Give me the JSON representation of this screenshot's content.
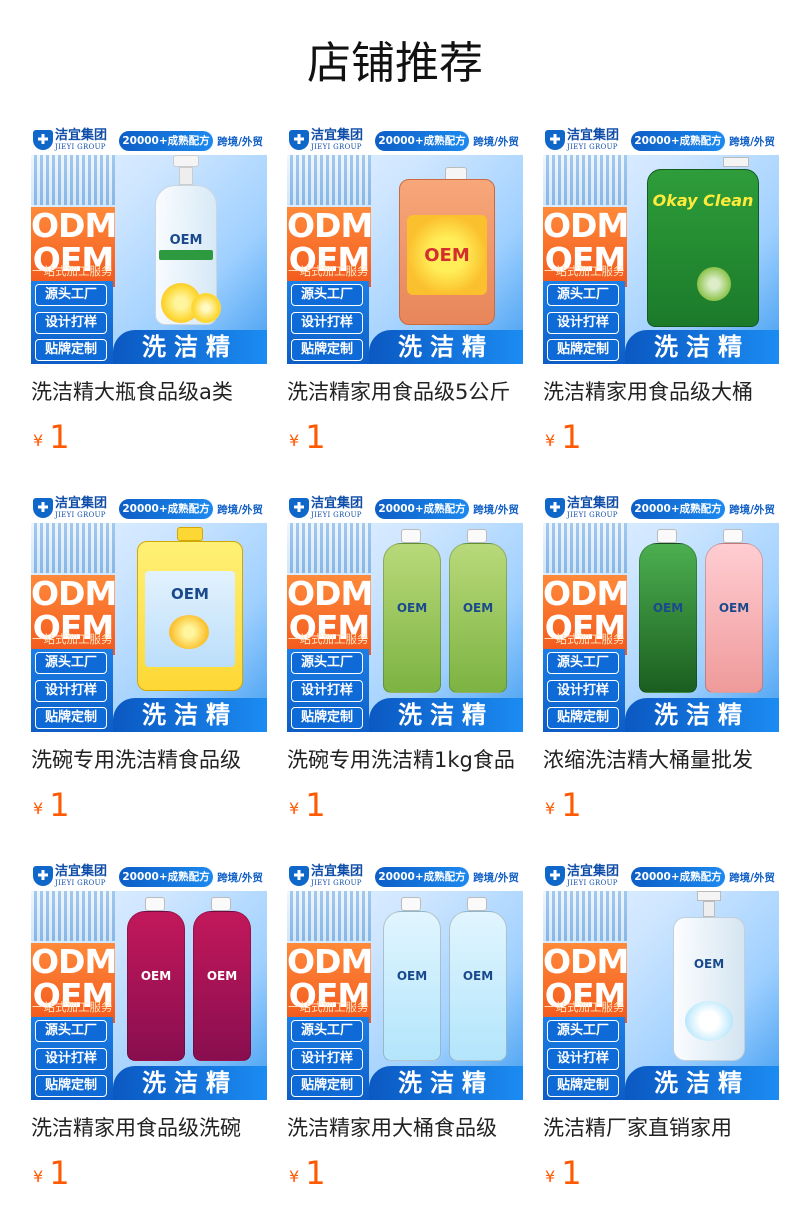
{
  "page": {
    "title": "店铺推荐"
  },
  "banner": {
    "brand": "洁宜集团",
    "brand_en": "JIEYI GROUP",
    "formula": "20000+成熟配方",
    "crossborder": "跨境/外贸",
    "odm": "ODM",
    "oem": "OEM",
    "service": "一站式加工服务",
    "tag1": "源头工厂",
    "tag2": "设计打样",
    "tag3": "贴牌定制",
    "bottom": "洗洁精"
  },
  "currency_symbol": "¥",
  "products": [
    {
      "title": "洗洁精大瓶食品级a类",
      "price": "1",
      "label": "OEM",
      "icon": "pump-bottle-lemon-icon"
    },
    {
      "title": "洗洁精家用食品级5公斤",
      "price": "1",
      "label": "OEM",
      "icon": "jerry-can-orange-icon"
    },
    {
      "title": "洗洁精家用食品级大桶",
      "price": "1",
      "label": "Okay Clean",
      "icon": "jug-green-icon"
    },
    {
      "title": "洗碗专用洗洁精食品级",
      "price": "1",
      "label": "OEM",
      "icon": "jug-yellow-icon"
    },
    {
      "title": "洗碗专用洗洁精1kg食品",
      "price": "1",
      "label": "OEM",
      "icon": "twin-bottles-green-icon"
    },
    {
      "title": "浓缩洗洁精大桶量批发",
      "price": "1",
      "label": "OEM",
      "icon": "twin-bottles-green-pink-icon"
    },
    {
      "title": "洗洁精家用食品级洗碗",
      "price": "1",
      "label": "OEM",
      "icon": "twin-bottles-red-icon"
    },
    {
      "title": "洗洁精家用大桶食品级",
      "price": "1",
      "label": "OEM",
      "icon": "twin-bottles-clear-icon"
    },
    {
      "title": "洗洁精厂家直销家用",
      "price": "1",
      "label": "OEM",
      "icon": "pump-bottle-clear-icon"
    }
  ]
}
